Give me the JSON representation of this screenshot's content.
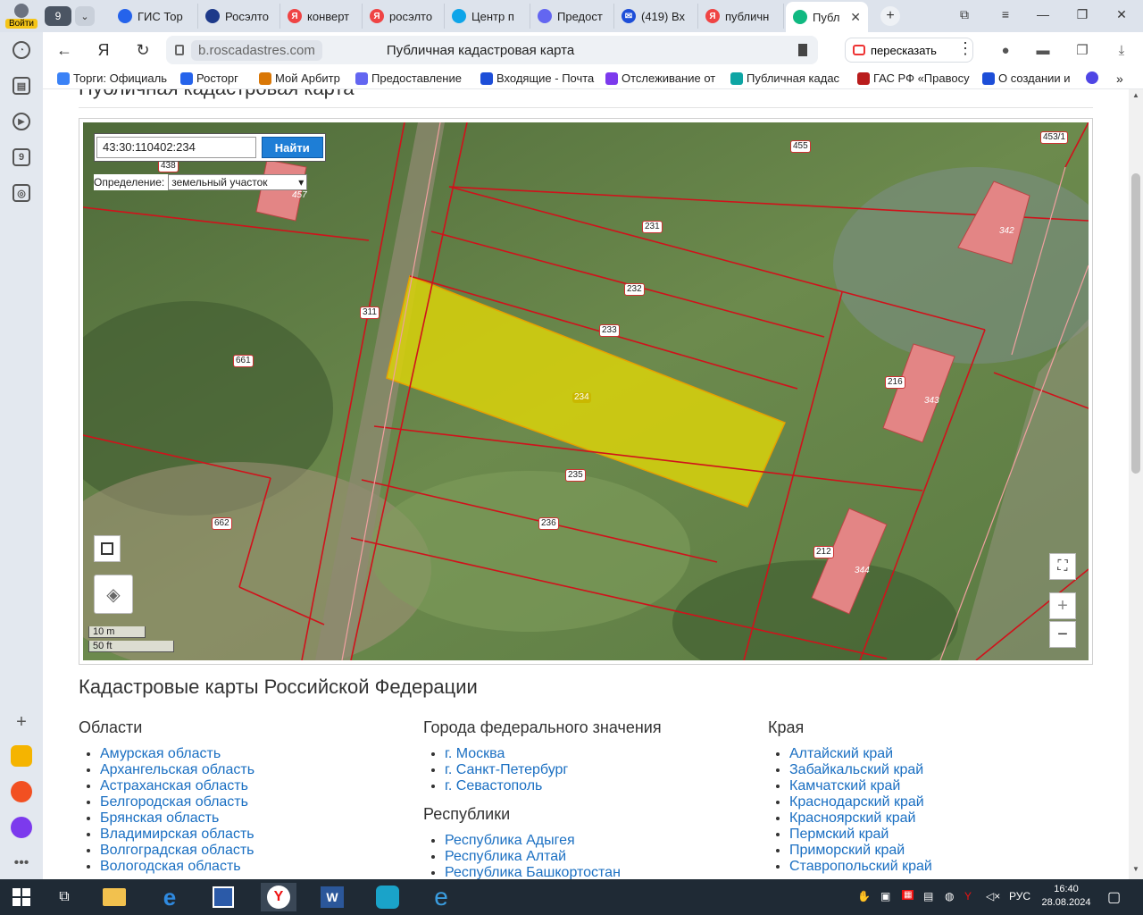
{
  "browser": {
    "login_label": "Войти",
    "tab_count": "9",
    "tabs": [
      {
        "label": "ГИС Тор",
        "icon": "gis-icon"
      },
      {
        "label": "Росэлто",
        "icon": "roselto-icon"
      },
      {
        "label": "конверт",
        "icon": "yandex-icon"
      },
      {
        "label": "росэлто",
        "icon": "yandex-icon"
      },
      {
        "label": "Центр п",
        "icon": "center-icon"
      },
      {
        "label": "Предост",
        "icon": "gosuslugi-icon"
      },
      {
        "label": "(419) Вх",
        "icon": "mail-icon"
      },
      {
        "label": "публичн",
        "icon": "yandex-icon"
      },
      {
        "label": "Публ",
        "icon": "rosreestr-icon"
      }
    ],
    "url_host": "b.roscadastres.com",
    "page_title": "Публичная кадастровая карта",
    "retell_label": "пересказать",
    "bookmarks": [
      {
        "label": "Торги: Официаль",
        "color": "#3b82f6"
      },
      {
        "label": "Росторг",
        "color": "#2563eb"
      },
      {
        "label": "Мой Арбитр",
        "color": "#d97706"
      },
      {
        "label": "Предоставление",
        "color": "#6366f1"
      },
      {
        "label": "Входящие - Почта",
        "color": "#1d4ed8"
      },
      {
        "label": "Отслеживание от",
        "color": "#7c3aed"
      },
      {
        "label": "Публичная кадас",
        "color": "#0ea5a4"
      },
      {
        "label": "ГАС РФ «Правосу",
        "color": "#b91c1c"
      },
      {
        "label": "О создании и",
        "color": "#1d4ed8"
      }
    ]
  },
  "page": {
    "title": "Публичная кадастровая карта"
  },
  "map": {
    "search_value": "43:30:110402:234",
    "search_button": "Найти",
    "definition_label": "Определение:",
    "definition_value": "земельный участок",
    "scale_m": "10 m",
    "scale_ft": "50 ft",
    "zoom_in": "+",
    "zoom_out": "−",
    "parcel_labels": [
      "438",
      "457",
      "455",
      "453/1",
      "342",
      "231",
      "232",
      "233",
      "234",
      "235",
      "236",
      "311",
      "661",
      "662",
      "216",
      "343",
      "212",
      "344"
    ],
    "highlight_color": "#d9d20a"
  },
  "section": {
    "title": "Кадастровые карты Российской Федерации",
    "oblasti_title": "Области",
    "oblasti": [
      "Амурская область",
      "Архангельская область",
      "Астраханская область",
      "Белгородская область",
      "Брянская область",
      "Владимирская область",
      "Волгоградская область",
      "Вологодская область"
    ],
    "cities_title": "Города федерального значения",
    "cities": [
      "г. Москва",
      "г. Санкт-Петербург",
      "г. Севастополь"
    ],
    "republics_title": "Республики",
    "republics": [
      "Республика Адыгея",
      "Республика Алтай",
      "Республика Башкортостан"
    ],
    "kraya_title": "Края",
    "kraya": [
      "Алтайский край",
      "Забайкальский край",
      "Камчатский край",
      "Краснодарский край",
      "Красноярский край",
      "Пермский край",
      "Приморский край",
      "Ставропольский край"
    ]
  },
  "taskbar": {
    "lang": "РУС",
    "time": "16:40",
    "date": "28.08.2024"
  }
}
